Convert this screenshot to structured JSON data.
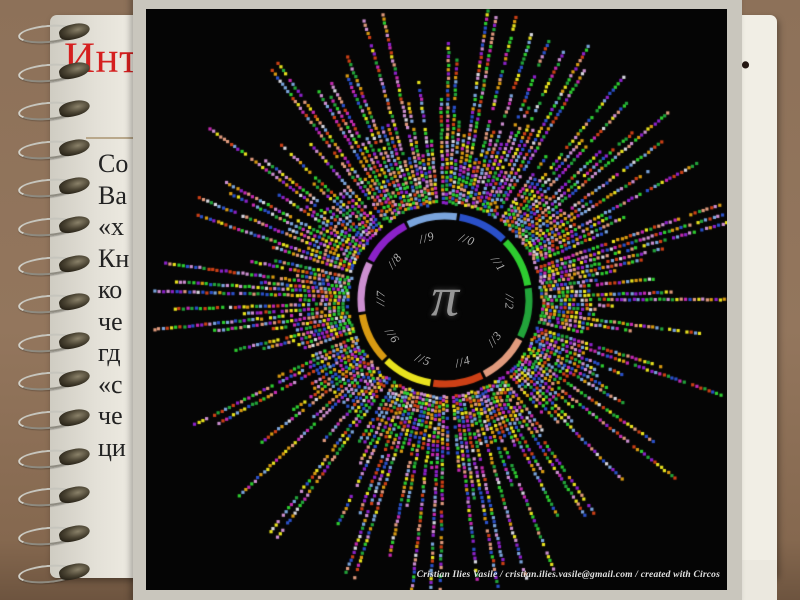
{
  "slide": {
    "title_fragment": "Инт",
    "title_period": ".",
    "body_line_fragments": [
      "Со",
      "Ва",
      "«х",
      "Кн",
      "ко",
      "че",
      "гд",
      "«с",
      "че",
      "ци"
    ]
  },
  "pi_image": {
    "center_symbol": "π",
    "credit": "Cristian Ilies Vasile / cristian.ilies.vasile@gmail.com / created with Circos"
  },
  "theme": {
    "background_brown": "#8d7159",
    "page_cream": "#f1eee5",
    "title_red": "#d51f1f",
    "rule_tan": "#b9a88b",
    "frame_gray": "#c9c6bd",
    "image_black": "#050505"
  },
  "chart_data": {
    "type": "scatter",
    "subtype": "circular starburst dot plot (Circos)",
    "title": "π",
    "description": "Digits of pi drawn as radial lines of tiny colored squares around a central ring; each digit 0–9 has a colored arc segment on the inner ring and dots are colored by digit value",
    "ring_labels": [
      "//0",
      "//1",
      "//2",
      "//3",
      "//4",
      "//5",
      "//6",
      "//7",
      "//8",
      "//9"
    ],
    "digits": [
      0,
      1,
      2,
      3,
      4,
      5,
      6,
      7,
      8,
      9
    ],
    "digit_arc_colors": [
      "#7aa4dc",
      "#2a50c8",
      "#2ecc30",
      "#22a33a",
      "#e09a7d",
      "#cc4016",
      "#e8e21e",
      "#d89a12",
      "#cc8fd0",
      "#8b22c8"
    ],
    "dot_palette_extra": [
      "#c32ab0",
      "#d9d9e2"
    ],
    "sectors": 10,
    "legend_position": "inner-ring",
    "grid": false,
    "background": "#050505"
  }
}
